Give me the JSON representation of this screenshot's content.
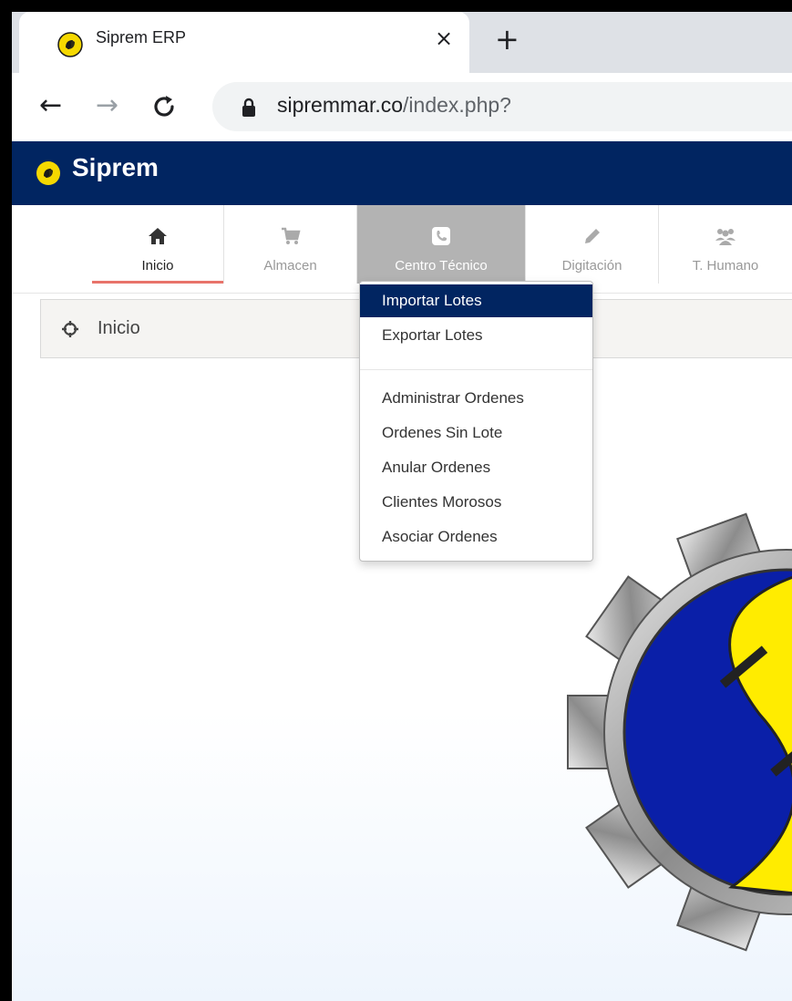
{
  "browser": {
    "tab_title": "Siprem ERP",
    "close_glyph": "×",
    "newtab_glyph": "+",
    "back_glyph": "←",
    "forward_glyph": "→",
    "reload_glyph": "C",
    "url_domain": "sipremmar.co",
    "url_path": "/index.php?"
  },
  "app": {
    "brand": "Siprem",
    "colors": {
      "header": "#012561",
      "accent_underline": "#e8736a",
      "logo_yellow": "#ffec00",
      "logo_blue": "#0a1fa8"
    }
  },
  "modules": [
    {
      "label": "Inicio",
      "icon": "home-icon",
      "active": true
    },
    {
      "label": "Almacen",
      "icon": "cart-icon"
    },
    {
      "label": "Centro Técnico",
      "icon": "phone-icon",
      "hover": true
    },
    {
      "label": "Digitación",
      "icon": "pencil-icon"
    },
    {
      "label": "T. Humano",
      "icon": "users-icon"
    }
  ],
  "breadcrumb": {
    "label": "Inicio",
    "icon": "crosshair-icon"
  },
  "dropdown": {
    "items": [
      "Importar Lotes",
      "Exportar Lotes",
      "Administrar Ordenes",
      "Ordenes Sin Lote",
      "Anular Ordenes",
      "Clientes Morosos",
      "Asociar Ordenes"
    ],
    "selected": "Importar Lotes"
  }
}
